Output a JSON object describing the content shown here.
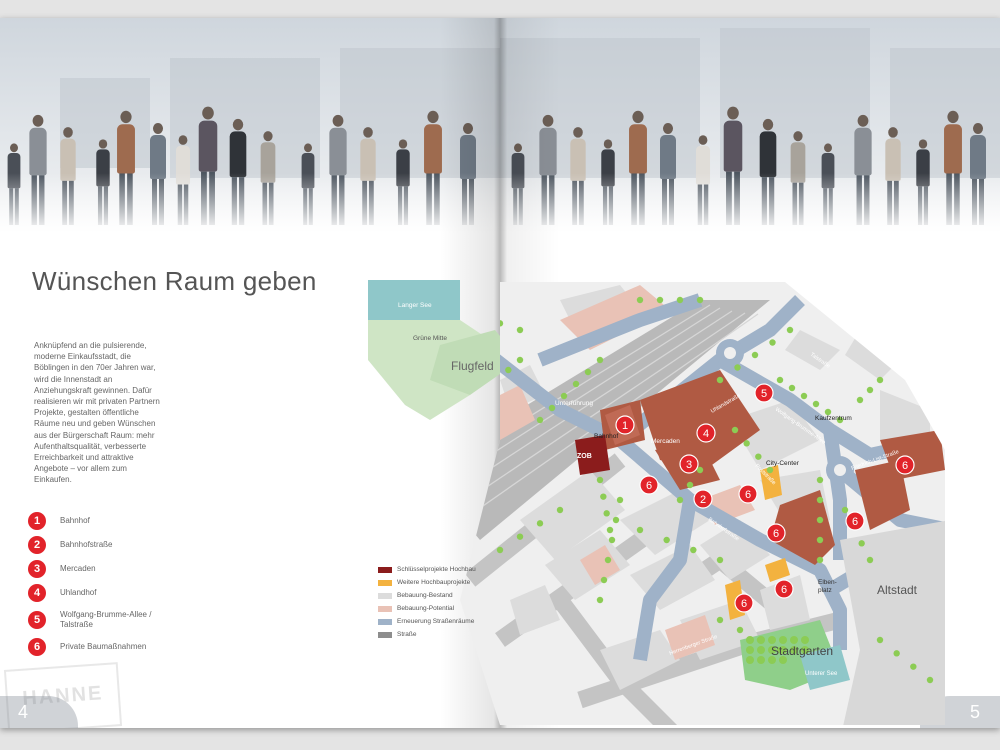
{
  "title": "Wünschen Raum geben",
  "intro_text": "Anknüpfend an die pulsierende, moderne Einkaufsstadt, die Böblingen in den 70er Jahren war, wird die Innenstadt an Anziehungskraft gewinnen. Dafür realisieren wir mit privaten Partnern Projekte, gestalten öffentliche Räume neu und geben Wünschen aus der Bürgerschaft Raum: mehr Aufenthaltsqualität, verbesserte Erreichbarkeit und attraktive Angebote – vor allem zum Einkaufen.",
  "projects": [
    {
      "num": "1",
      "label": "Bahnhof"
    },
    {
      "num": "2",
      "label": "Bahnhofstraße"
    },
    {
      "num": "3",
      "label": "Mercaden"
    },
    {
      "num": "4",
      "label": "Uhlandhof"
    },
    {
      "num": "5",
      "label": "Wolfgang-Brumme-Allee / Talstraße"
    },
    {
      "num": "6",
      "label": "Private Baumaßnahmen"
    }
  ],
  "page_numbers": {
    "left": "4",
    "right": "5"
  },
  "legend": [
    {
      "label": "Schlüsselprojekte Hochbau",
      "color": "#8b1c1c"
    },
    {
      "label": "Weitere Hochbauprojekte",
      "color": "#f3b23f"
    },
    {
      "label": "Bebauung-Bestand",
      "color": "#dcdcdc"
    },
    {
      "label": "Bebauung-Potential",
      "color": "#e9c2b6"
    },
    {
      "label": "Erneuerung Straßenräume",
      "color": "#9fb2c8"
    },
    {
      "label": "Straße",
      "color": "#8d8d8d"
    }
  ],
  "map_labels": {
    "langer_see": "Langer See",
    "gruene_mitte": "Grüne Mitte",
    "flugfeld": "Flugfeld",
    "unterfuehrung": "Unterführung",
    "bahnhof": "Bahnhof",
    "zob": "ZOB",
    "mercaden": "Mercaden",
    "uhlandstrasse": "Uhlandstraße",
    "city_center": "City-Center",
    "kaufzentrum": "Kaufzentrum",
    "talstrasse": "Talstraße",
    "wolfgang_brumme_allee": "Wolfgang-Brumme-Allee",
    "bahnhofstrasse": "Bahnhofstraße",
    "poststrasse": "Poststraße",
    "elbenplatz": "Elben-\nplatz",
    "altstadt": "Altstadt",
    "stadtgarten": "Stadtgarten",
    "unterer_see": "Unterer See",
    "herrenberger_strasse": "Herrenberger Straße",
    "friedrich_list_strasse": "Friedrich-List-Straße"
  },
  "stamp_text": "HANNE"
}
